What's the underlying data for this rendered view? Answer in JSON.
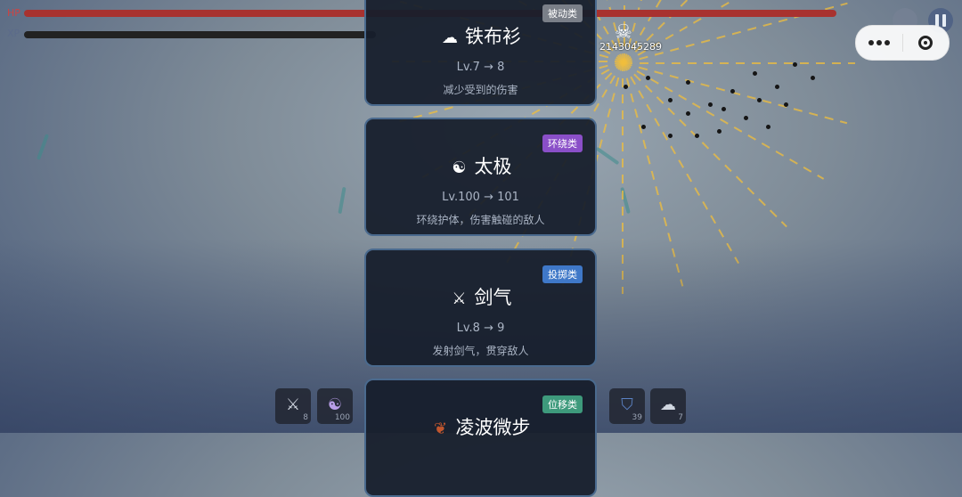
{
  "hud": {
    "hp_label": "HP",
    "xp_label": "XP",
    "hp_fraction": 0.97,
    "xp_fraction": 0.42,
    "damage_text": "2143045289",
    "kill_icon": "skull-icon"
  },
  "topbar": {
    "chart_icon": "bar-chart-icon",
    "pause_icon": "pause-icon",
    "more_icon": "more-dots-icon",
    "close_icon": "target-circle-icon"
  },
  "cards": [
    {
      "tag": "被动类",
      "tag_color": "#7a7f88",
      "icon": "cloud-icon",
      "name": "铁布衫",
      "level": "Lv.7 → 8",
      "desc": "减少受到的伤害"
    },
    {
      "tag": "环绕类",
      "tag_color": "#8a4fc8",
      "icon": "yin-yang-icon",
      "name": "太极",
      "level": "Lv.100 → 101",
      "desc": "环绕护体，伤害触碰的敌人"
    },
    {
      "tag": "投掷类",
      "tag_color": "#3f78c8",
      "icon": "crossed-swords-icon",
      "name": "剑气",
      "level": "Lv.8 → 9",
      "desc": "发射剑气，贯穿敌人"
    },
    {
      "tag": "位移类",
      "tag_color": "#3e9a7c",
      "icon": "footprints-icon",
      "name": "凌波微步",
      "level": "",
      "desc": ""
    }
  ],
  "skill_slots": [
    {
      "icon": "crossed-swords-icon",
      "level": "8"
    },
    {
      "icon": "yin-yang-icon",
      "level": "100"
    },
    {
      "icon": "shield-icon",
      "level": "39"
    },
    {
      "icon": "cloud-icon",
      "level": "7"
    }
  ]
}
